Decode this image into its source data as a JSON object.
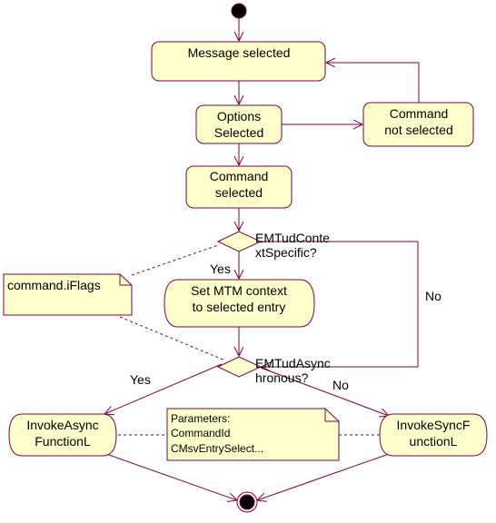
{
  "colors": {
    "stroke": "#800040",
    "fill": "#ffffcc",
    "text": "#000000",
    "background": "#ffffff"
  },
  "states": {
    "message_selected": "Message selected",
    "options_selected": [
      "Options",
      "Selected"
    ],
    "command_not_selected": [
      "Command",
      "not selected"
    ],
    "command_selected": [
      "Command",
      "selected"
    ],
    "set_mtm_context": [
      "Set MTM context",
      "to selected entry"
    ],
    "invoke_async": [
      "InvokeAsync",
      "FunctionL"
    ],
    "invoke_sync": [
      "InvokeSyncF",
      "unctionL"
    ]
  },
  "decisions": {
    "context_specific": [
      "EMTudConte",
      "xtSpecific?"
    ],
    "asynchronous": [
      "EMTudAsync",
      "hronous?"
    ]
  },
  "guards": {
    "context_yes": "Yes",
    "context_no": "No",
    "async_yes": "Yes",
    "async_no": "No"
  },
  "notes": {
    "flags_note": [
      "command.iFlags"
    ],
    "params_note": [
      "Parameters:",
      "CommandId",
      "CMsvEntrySelect..."
    ]
  }
}
